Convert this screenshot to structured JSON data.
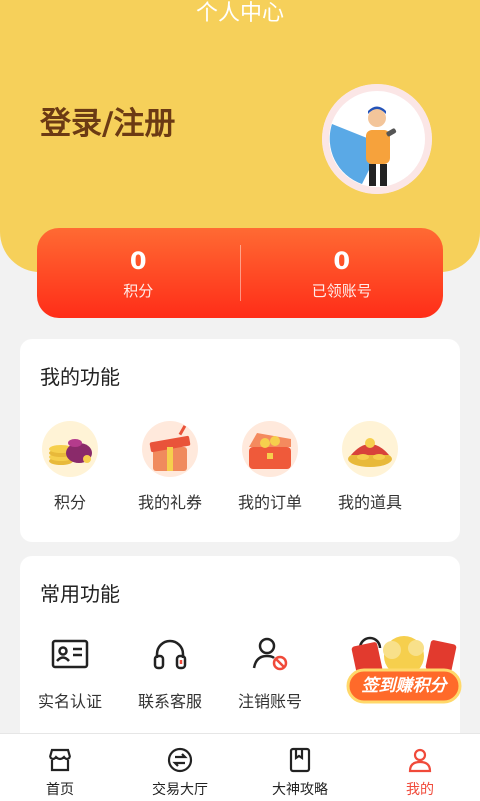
{
  "header": {
    "title": "个人中心",
    "login_label": "登录/注册"
  },
  "stats": [
    {
      "value": "0",
      "label": "积分"
    },
    {
      "value": "0",
      "label": "已领账号"
    }
  ],
  "my_functions": {
    "title": "我的功能",
    "items": [
      {
        "label": "积分",
        "icon": "gold-coins-icon"
      },
      {
        "label": "我的礼券",
        "icon": "gift-box-icon"
      },
      {
        "label": "我的订单",
        "icon": "treasure-chest-icon"
      },
      {
        "label": "我的道具",
        "icon": "gold-ingot-icon"
      }
    ]
  },
  "common_functions": {
    "title": "常用功能",
    "items": [
      {
        "label": "实名认证",
        "icon": "id-card-icon"
      },
      {
        "label": "联系客服",
        "icon": "headset-icon"
      },
      {
        "label": "注销账号",
        "icon": "user-forbidden-icon"
      }
    ]
  },
  "promo": {
    "label": "签到赚积分"
  },
  "tabbar": {
    "items": [
      {
        "label": "首页",
        "icon": "store-icon"
      },
      {
        "label": "交易大厅",
        "icon": "exchange-icon"
      },
      {
        "label": "大神攻略",
        "icon": "book-icon"
      },
      {
        "label": "我的",
        "icon": "user-icon"
      }
    ],
    "active_index": 3
  },
  "colors": {
    "header_bg": "#f6d05a",
    "accent": "#f04a3a",
    "login_text": "#6b3a14"
  }
}
